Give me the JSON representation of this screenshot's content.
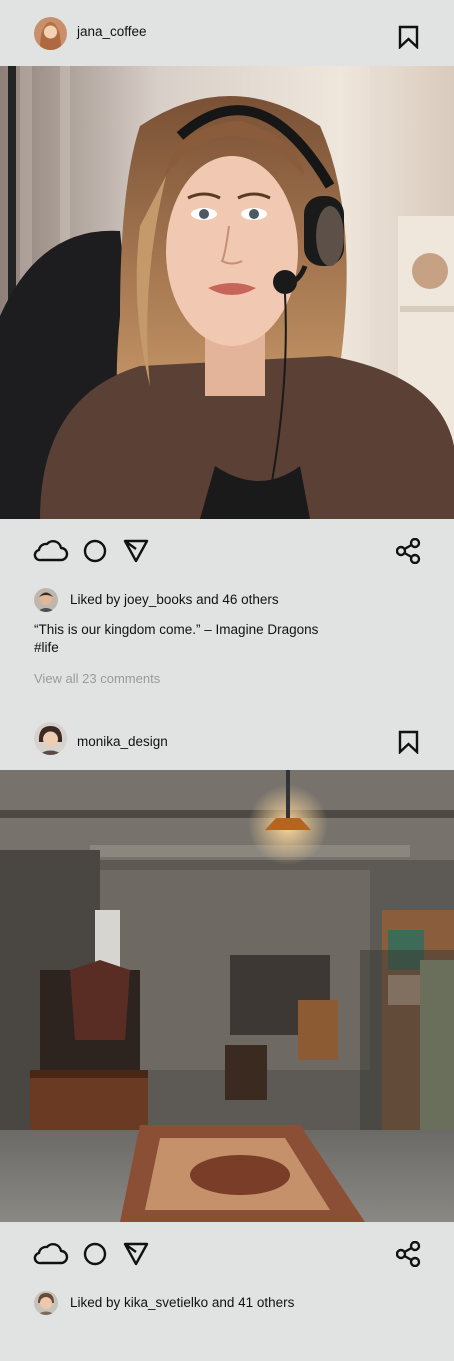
{
  "posts": [
    {
      "username": "jana_coffee",
      "likes_prefix": "Liked by ",
      "liked_by_user": "joey_books",
      "likes_suffix": " and 46 others",
      "caption": "“This is our kingdom come.” – Imagine Dragons",
      "hashtag": "#life",
      "comments_link": "View all 23 comments"
    },
    {
      "username": "monika_design",
      "likes_prefix": "Liked by ",
      "liked_by_user": "kika_svetielko",
      "likes_suffix": " and 41 others"
    }
  ],
  "icons": {
    "bookmark": "bookmark-icon",
    "like": "cloud-icon",
    "comment": "circle-comment-icon",
    "send": "send-triangle-icon",
    "share": "share-icon"
  },
  "colors": {
    "background": "#e1e3e3",
    "text": "#111111",
    "muted": "#9a9a9a"
  }
}
